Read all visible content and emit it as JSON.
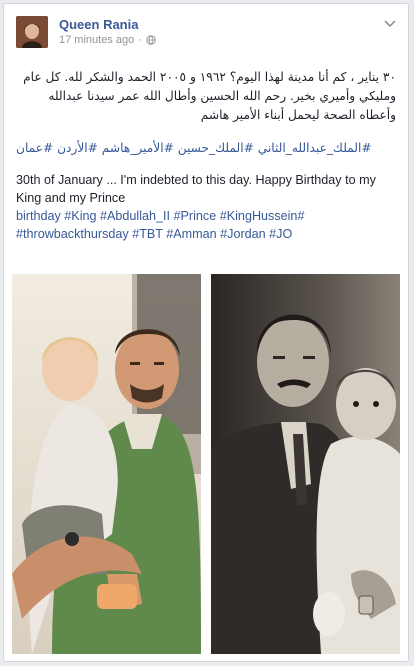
{
  "post": {
    "author": "Queen Rania",
    "time": "17 minutes ago",
    "privacy_icon": "globe-icon",
    "menu_icon": "chevron-down-icon",
    "arabic_text": "٣٠ يناير ، كم أنا مدينة لهذا اليوم؟ ١٩٦٢ و ٢٠٠٥ الحمد والشكر لله. كل عام ومليكي وأميري بخير. رحم الله الحسين وأطال الله عمر سيدنا عبدالله وأعطاه الصحة ليحمل أبناء الأمير هاشم",
    "arabic_hashtags": [
      "#الملك_عبدالله_الثاني",
      "#الملك_حسين",
      "#الأمير_هاشم",
      "#الأردن",
      "#عمان"
    ],
    "english_text": "30th of January ... I'm indebted to this day. Happy Birthday to my King and my Prince",
    "english_hashtags_line1": "birthday #King #Abdullah_II #Prince #KingHussein#",
    "english_hashtags_line2": "#throwbackthursday #TBT #Amman #Jordan #JO"
  },
  "colors": {
    "link": "#365899",
    "author": "#3b5998",
    "meta": "#90949c",
    "text": "#1d2129"
  }
}
